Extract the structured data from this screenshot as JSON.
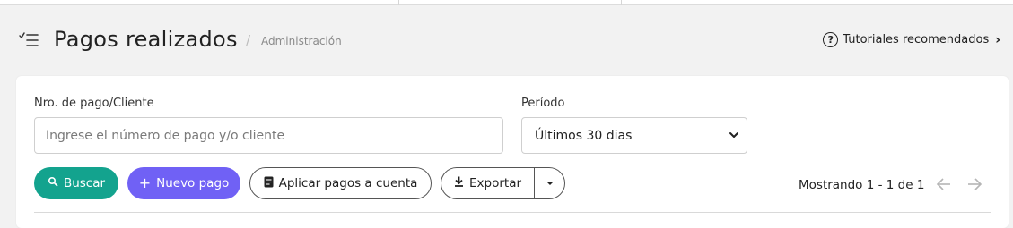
{
  "header": {
    "title": "Pagos realizados",
    "breadcrumb_sep": "/",
    "breadcrumb": "Administración",
    "tutorials_label": "Tutoriales recomendados",
    "tutorials_icon": "question-circle-icon"
  },
  "filters": {
    "client_label": "Nro. de pago/Cliente",
    "client_placeholder": "Ingrese el número de pago y/o cliente",
    "client_value": "",
    "period_label": "Período",
    "period_selected": "Últimos 30 dias"
  },
  "actions": {
    "search_label": "Buscar",
    "new_payment_label": "Nuevo pago",
    "apply_label": "Aplicar pagos a cuenta",
    "export_label": "Exportar"
  },
  "pagination": {
    "showing_text": "Mostrando 1 - 1 de 1"
  },
  "colors": {
    "search_button": "#13a38e",
    "new_button": "#7061f5",
    "background": "#f2f2f2",
    "card": "#ffffff"
  }
}
